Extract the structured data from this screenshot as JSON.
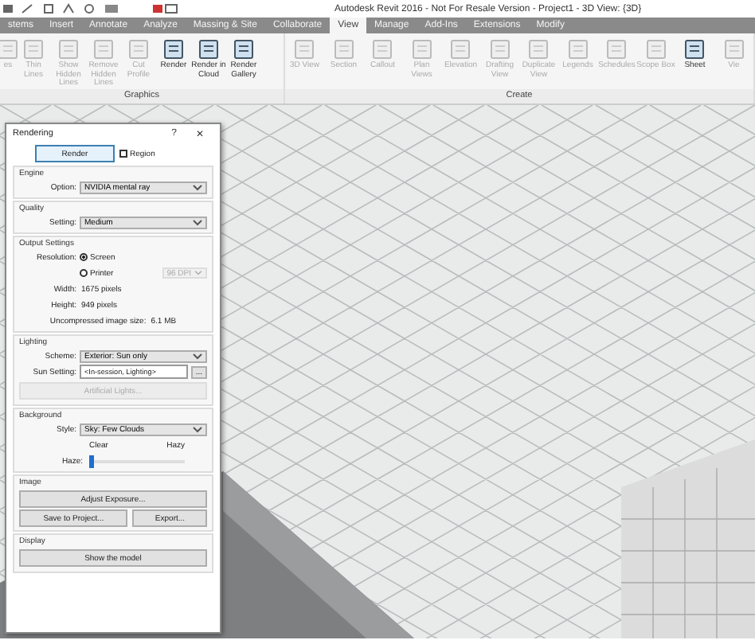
{
  "window": {
    "title": "Autodesk Revit 2016 - Not For Resale Version -    Project1 - 3D View: {3D}"
  },
  "tabs": [
    {
      "label": "stems",
      "selected": false
    },
    {
      "label": "Insert",
      "selected": false
    },
    {
      "label": "Annotate",
      "selected": false
    },
    {
      "label": "Analyze",
      "selected": false
    },
    {
      "label": "Massing & Site",
      "selected": false
    },
    {
      "label": "Collaborate",
      "selected": false
    },
    {
      "label": "View",
      "selected": true
    },
    {
      "label": "Manage",
      "selected": false
    },
    {
      "label": "Add-Ins",
      "selected": false
    },
    {
      "label": "Extensions",
      "selected": false
    },
    {
      "label": "Modify",
      "selected": false
    }
  ],
  "ribbon": {
    "panels": [
      {
        "label": "Graphics",
        "buttons": [
          {
            "label": "es",
            "disabled": true
          },
          {
            "label": "Thin Lines",
            "disabled": true
          },
          {
            "label": "Show Hidden Lines",
            "disabled": true
          },
          {
            "label": "Remove Hidden Lines",
            "disabled": true
          },
          {
            "label": "Cut Profile",
            "disabled": true
          },
          {
            "label": "Render",
            "disabled": false
          },
          {
            "label": "Render in Cloud",
            "disabled": false
          },
          {
            "label": "Render Gallery",
            "disabled": false
          }
        ]
      },
      {
        "label": "Create",
        "buttons": [
          {
            "label": "3D View",
            "disabled": true
          },
          {
            "label": "Section",
            "disabled": true
          },
          {
            "label": "Callout",
            "disabled": true
          },
          {
            "label": "Plan Views",
            "disabled": true
          },
          {
            "label": "Elevation",
            "disabled": true
          },
          {
            "label": "Drafting View",
            "disabled": true
          },
          {
            "label": "Duplicate View",
            "disabled": true
          },
          {
            "label": "Legends",
            "disabled": true
          },
          {
            "label": "Schedules",
            "disabled": true
          },
          {
            "label": "Scope Box",
            "disabled": true
          },
          {
            "label": "Sheet",
            "disabled": false
          },
          {
            "label": "Vie",
            "disabled": true
          }
        ]
      }
    ]
  },
  "dialog": {
    "title": "Rendering",
    "help": "?",
    "close": "✕",
    "render_button": "Render",
    "region": {
      "label": "Region",
      "checked": false
    },
    "engine": {
      "heading": "Engine",
      "label": "Option:",
      "value": "NVIDIA mental ray"
    },
    "quality": {
      "heading": "Quality",
      "label": "Setting:",
      "value": "Medium"
    },
    "output": {
      "heading": "Output Settings",
      "label": "Resolution:",
      "options": [
        {
          "label": "Screen",
          "selected": true
        },
        {
          "label": "Printer",
          "selected": false
        }
      ],
      "dpi": "96 DPI",
      "width_label": "Width:",
      "width": "1675 pixels",
      "height_label": "Height:",
      "height": "949 pixels",
      "size_label": "Uncompressed image size:",
      "size": "6.1 MB"
    },
    "lighting": {
      "heading": "Lighting",
      "scheme_label": "Scheme:",
      "scheme": "Exterior: Sun only",
      "sun_label": "Sun Setting:",
      "sun": "<In-session, Lighting>",
      "sun_more": "...",
      "artificial": {
        "label": "Artificial Lights...",
        "disabled": true
      }
    },
    "background": {
      "heading": "Background",
      "style_label": "Style:",
      "style": "Sky: Few Clouds",
      "clear": "Clear",
      "hazy": "Hazy",
      "haze_label": "Haze:",
      "haze": {
        "level": 0
      }
    },
    "image": {
      "heading": "Image",
      "adjust": "Adjust Exposure...",
      "save": "Save to Project...",
      "export": "Export..."
    },
    "display": {
      "heading": "Display",
      "show": "Show the model"
    }
  }
}
